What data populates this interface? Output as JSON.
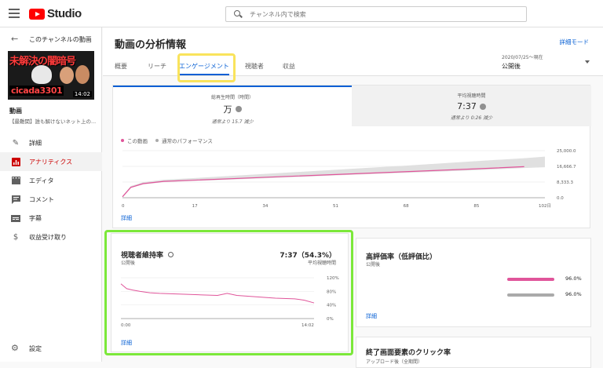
{
  "app": {
    "logo_text": "Studio"
  },
  "search": {
    "placeholder": "チャンネル内で検索"
  },
  "sidebar": {
    "back_label": "このチャンネルの動画",
    "thumbnail": {
      "title_text": "未解決の闇暗号",
      "channel_text": "cicada3301",
      "duration": "14:02"
    },
    "video_title": "動画",
    "video_subtitle": "【最難関】誰も解けないネット上の...",
    "items": [
      {
        "label": "詳細",
        "icon": "pencil-icon"
      },
      {
        "label": "アナリティクス",
        "icon": "analytics-icon",
        "active": true
      },
      {
        "label": "エディタ",
        "icon": "film-icon"
      },
      {
        "label": "コメント",
        "icon": "comment-icon"
      },
      {
        "label": "字幕",
        "icon": "subtitles-icon"
      },
      {
        "label": "収益受け取り",
        "icon": "dollar-icon"
      }
    ],
    "settings_label": "設定"
  },
  "main": {
    "title": "動画の分析情報",
    "advanced_mode": "詳細モード",
    "tabs": [
      {
        "label": "概要"
      },
      {
        "label": "リーチ"
      },
      {
        "label": "エンゲージメント",
        "active": true
      },
      {
        "label": "視聴者"
      },
      {
        "label": "収益"
      }
    ],
    "date_range": "2020/07/25～現在",
    "date_value": "公開後"
  },
  "metrics": {
    "watch_time": {
      "label": "総再生時間（時間）",
      "value": "万",
      "compare": "通常より 15.7 減少"
    },
    "avg_duration": {
      "label": "平均視聴時間",
      "value": "7:37",
      "compare": "通常より 0:26 減少"
    }
  },
  "legend": {
    "this_video": "この動画",
    "typical": "通常のパフォーマンス"
  },
  "detail_link": "詳細",
  "retention": {
    "title": "視聴者維持率",
    "subtitle": "公開後",
    "value": "7:37（54.3%）",
    "value_sub": "平均視聴時間",
    "detail_link": "詳細"
  },
  "rating": {
    "title": "高評価率（低評価比）",
    "subtitle": "公開後",
    "detail_link": "詳細",
    "values": [
      {
        "value": "96.0%",
        "fraction": 0.96,
        "color": "#e0559a"
      },
      {
        "value": "96.0%",
        "fraction": 0.96,
        "color": "#aaaaaa"
      }
    ]
  },
  "endscreen": {
    "title": "終了画面要素のクリック率",
    "subtitle": "アップロード後（全期間）"
  },
  "colors": {
    "accent": "#065fd4",
    "series": "#e0559a",
    "band": "#e0e0e0"
  },
  "chart_data": [
    {
      "type": "line",
      "x_ticks": [
        "0",
        "17",
        "34",
        "51",
        "68",
        "85",
        "102日"
      ],
      "y_ticks": [
        "0.0",
        "8,333.3",
        "16,666.7",
        "25,000.0"
      ],
      "ylim": [
        0,
        25000
      ],
      "xlim": [
        0,
        102
      ],
      "series": [
        {
          "name": "この動画",
          "x": [
            0,
            2,
            5,
            10,
            17,
            34,
            51,
            68,
            85,
            97
          ],
          "y": [
            500,
            5500,
            7500,
            8700,
            9300,
            10800,
            12300,
            13800,
            15300,
            16500
          ]
        },
        {
          "name": "通常のパフォーマンス",
          "x": [
            0,
            2,
            5,
            10,
            17,
            34,
            51,
            68,
            85,
            97,
            102
          ],
          "y_low": [
            300,
            5200,
            7100,
            8300,
            8900,
            10300,
            11800,
            13200,
            14600,
            15800,
            16200
          ],
          "y_high": [
            1000,
            6200,
            8300,
            9600,
            10400,
            12600,
            14800,
            17000,
            19400,
            21000,
            21800
          ]
        }
      ]
    },
    {
      "type": "line",
      "x_ticks": [
        "0:00",
        "14:02"
      ],
      "y_ticks": [
        "0%",
        "40%",
        "80%",
        "120%"
      ],
      "ylim": [
        0,
        120
      ],
      "series": [
        {
          "name": "視聴者維持率",
          "x": [
            0,
            0.03,
            0.06,
            0.1,
            0.15,
            0.2,
            0.3,
            0.4,
            0.5,
            0.55,
            0.6,
            0.7,
            0.8,
            0.9,
            0.95,
            1.0
          ],
          "y": [
            102,
            88,
            84,
            80,
            76,
            74,
            72,
            70,
            68,
            74,
            68,
            64,
            60,
            58,
            54,
            46
          ]
        }
      ]
    }
  ]
}
